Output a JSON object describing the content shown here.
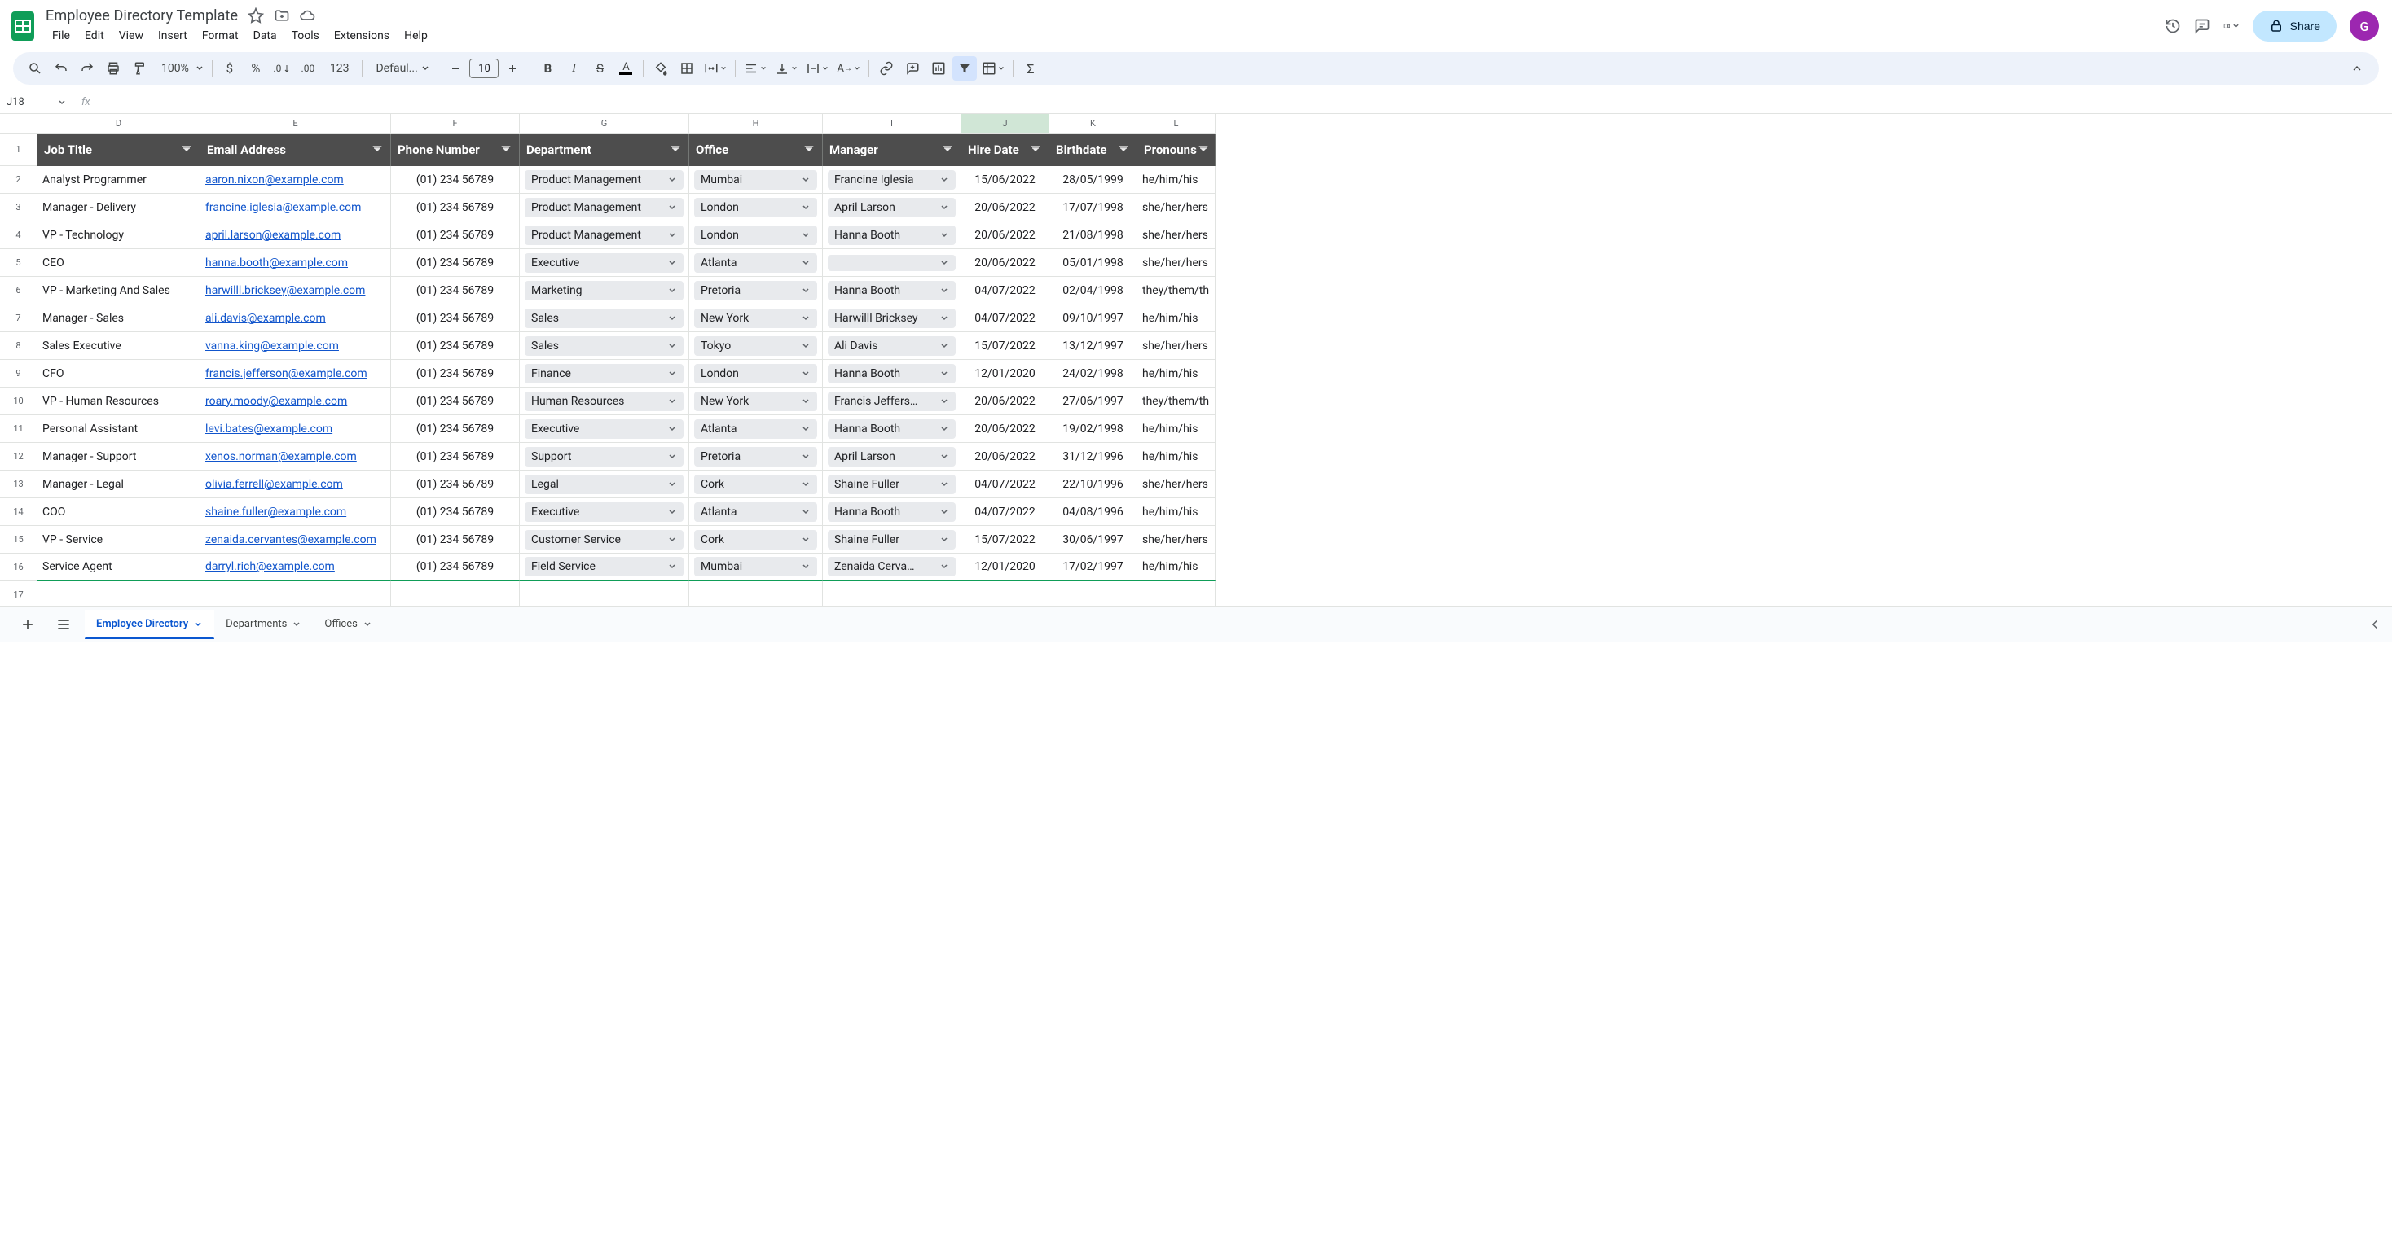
{
  "doc": {
    "title": "Employee Directory Template",
    "avatar_initial": "G"
  },
  "menus": [
    "File",
    "Edit",
    "View",
    "Insert",
    "Format",
    "Data",
    "Tools",
    "Extensions",
    "Help"
  ],
  "share_label": "Share",
  "toolbar": {
    "zoom": "100%",
    "font": "Defaul...",
    "font_size": "10",
    "number_fmt": "123"
  },
  "name_box": "J18",
  "columns": [
    "D",
    "E",
    "F",
    "G",
    "H",
    "I",
    "J",
    "K",
    "L"
  ],
  "selected_col": "J",
  "headers": [
    "Job Title",
    "Email Address",
    "Phone Number",
    "Department",
    "Office",
    "Manager",
    "Hire Date",
    "Birthdate",
    "Pronouns"
  ],
  "rows": [
    {
      "n": 1,
      "job": "Analyst Programmer",
      "email": "aaron.nixon@example.com",
      "phone": "(01) 234 56789",
      "dept": "Product Management",
      "office": "Mumbai",
      "manager": "Francine Iglesia",
      "hire": "15/06/2022",
      "birth": "28/05/1999",
      "pron": "he/him/his"
    },
    {
      "n": 2,
      "job": "Manager - Delivery",
      "email": "francine.iglesia@example.com",
      "phone": "(01) 234 56789",
      "dept": "Product Management",
      "office": "London",
      "manager": "April Larson",
      "hire": "20/06/2022",
      "birth": "17/07/1998",
      "pron": "she/her/hers"
    },
    {
      "n": 3,
      "job": "VP - Technology",
      "email": "april.larson@example.com",
      "phone": "(01) 234 56789",
      "dept": "Product Management",
      "office": "London",
      "manager": "Hanna Booth",
      "hire": "20/06/2022",
      "birth": "21/08/1998",
      "pron": "she/her/hers"
    },
    {
      "n": 4,
      "job": "CEO",
      "email": "hanna.booth@example.com",
      "phone": "(01) 234 56789",
      "dept": "Executive",
      "office": "Atlanta",
      "manager": "",
      "hire": "20/06/2022",
      "birth": "05/01/1998",
      "pron": "she/her/hers"
    },
    {
      "n": 5,
      "job": "VP - Marketing And Sales",
      "email": "harwilll.bricksey@example.com",
      "phone": "(01) 234 56789",
      "dept": "Marketing",
      "office": "Pretoria",
      "manager": "Hanna Booth",
      "hire": "04/07/2022",
      "birth": "02/04/1998",
      "pron": "they/them/th"
    },
    {
      "n": 6,
      "job": "Manager - Sales",
      "email": "ali.davis@example.com",
      "phone": "(01) 234 56789",
      "dept": "Sales",
      "office": "New York",
      "manager": "Harwilll Bricksey",
      "hire": "04/07/2022",
      "birth": "09/10/1997",
      "pron": "he/him/his"
    },
    {
      "n": 7,
      "job": "Sales Executive",
      "email": "vanna.king@example.com",
      "phone": "(01) 234 56789",
      "dept": "Sales",
      "office": "Tokyo",
      "manager": "Ali Davis",
      "hire": "15/07/2022",
      "birth": "13/12/1997",
      "pron": "she/her/hers"
    },
    {
      "n": 8,
      "job": "CFO",
      "email": "francis.jefferson@example.com",
      "phone": "(01) 234 56789",
      "dept": "Finance",
      "office": "London",
      "manager": "Hanna Booth",
      "hire": "12/01/2020",
      "birth": "24/02/1998",
      "pron": "he/him/his"
    },
    {
      "n": 9,
      "job": "VP - Human Resources",
      "email": "roary.moody@example.com",
      "phone": "(01) 234 56789",
      "dept": "Human Resources",
      "office": "New York",
      "manager": "Francis Jeffers…",
      "hire": "20/06/2022",
      "birth": "27/06/1997",
      "pron": "they/them/th"
    },
    {
      "n": 10,
      "job": "Personal Assistant",
      "email": "levi.bates@example.com",
      "phone": "(01) 234 56789",
      "dept": "Executive",
      "office": "Atlanta",
      "manager": "Hanna Booth",
      "hire": "20/06/2022",
      "birth": "19/02/1998",
      "pron": "he/him/his"
    },
    {
      "n": 11,
      "job": "Manager - Support",
      "email": "xenos.norman@example.com",
      "phone": "(01) 234 56789",
      "dept": "Support",
      "office": "Pretoria",
      "manager": "April Larson",
      "hire": "20/06/2022",
      "birth": "31/12/1996",
      "pron": "he/him/his"
    },
    {
      "n": 12,
      "job": "Manager - Legal",
      "email": "olivia.ferrell@example.com",
      "phone": "(01) 234 56789",
      "dept": "Legal",
      "office": "Cork",
      "manager": "Shaine Fuller",
      "hire": "04/07/2022",
      "birth": "22/10/1996",
      "pron": "she/her/hers"
    },
    {
      "n": 13,
      "job": "COO",
      "email": "shaine.fuller@example.com",
      "phone": "(01) 234 56789",
      "dept": "Executive",
      "office": "Atlanta",
      "manager": "Hanna Booth",
      "hire": "04/07/2022",
      "birth": "04/08/1996",
      "pron": "he/him/his"
    },
    {
      "n": 14,
      "job": "VP - Service",
      "email": "zenaida.cervantes@example.com",
      "phone": "(01) 234 56789",
      "dept": "Customer Service",
      "office": "Cork",
      "manager": "Shaine Fuller",
      "hire": "15/07/2022",
      "birth": "30/06/1997",
      "pron": "she/her/hers"
    },
    {
      "n": 15,
      "job": "Service Agent",
      "email": "darryl.rich@example.com",
      "phone": "(01) 234 56789",
      "dept": "Field Service",
      "office": "Mumbai",
      "manager": "Zenaida Cerva…",
      "hire": "12/01/2020",
      "birth": "17/02/1997",
      "pron": "he/him/his"
    }
  ],
  "empty_row": 17,
  "sheets": [
    {
      "name": "Employee Directory",
      "active": true
    },
    {
      "name": "Departments",
      "active": false
    },
    {
      "name": "Offices",
      "active": false
    }
  ]
}
